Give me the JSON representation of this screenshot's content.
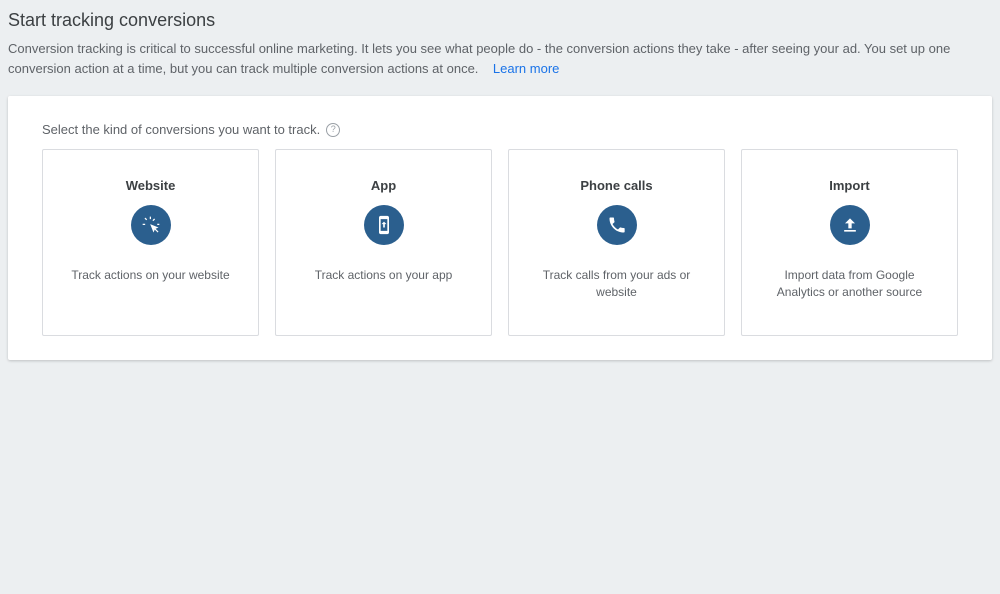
{
  "header": {
    "title": "Start tracking conversions",
    "description": "Conversion tracking is critical to successful online marketing. It lets you see what people do - the conversion actions they take - after seeing your ad. You set up one conversion action at a time, but you can track multiple conversion actions at once.",
    "learn_more": "Learn more"
  },
  "panel": {
    "instruction": "Select the kind of conversions you want to track.",
    "help_glyph": "?"
  },
  "options": [
    {
      "title": "Website",
      "description": "Track actions on your website",
      "icon": "cursor-click-icon"
    },
    {
      "title": "App",
      "description": "Track actions on your app",
      "icon": "mobile-app-icon"
    },
    {
      "title": "Phone calls",
      "description": "Track calls from your ads or website",
      "icon": "phone-icon"
    },
    {
      "title": "Import",
      "description": "Import data from Google Analytics or another source",
      "icon": "upload-icon"
    }
  ]
}
